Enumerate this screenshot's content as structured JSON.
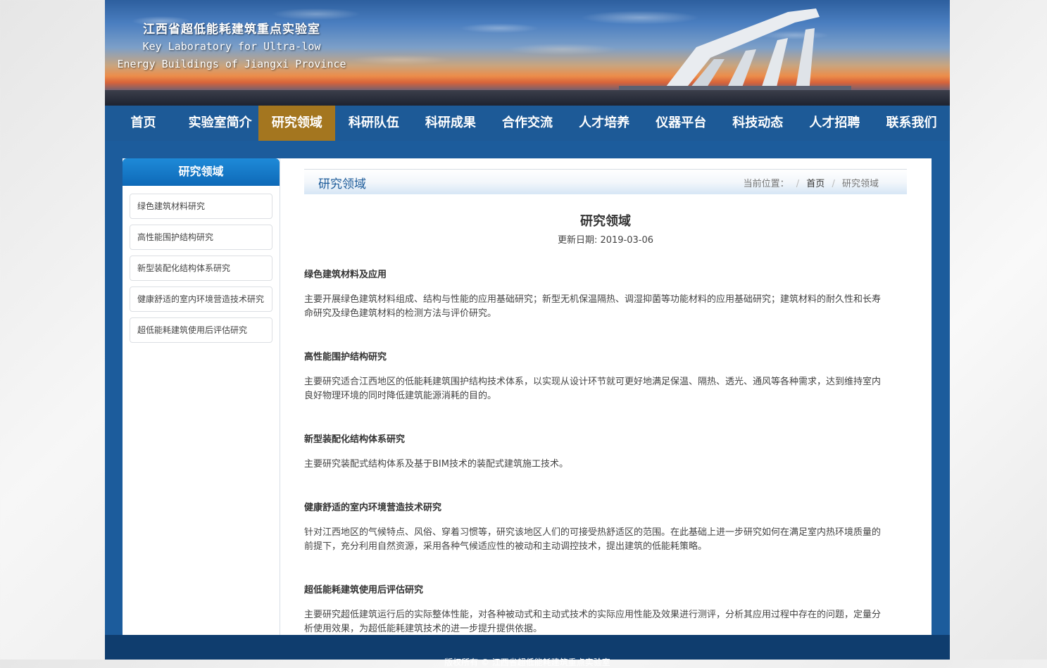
{
  "header": {
    "title_zh": "江西省超低能耗建筑重点实验室",
    "title_en_1": "Key Laboratory for Ultra-low",
    "title_en_2": "Energy Buildings of Jiangxi Province"
  },
  "nav": {
    "items": [
      "首页",
      "实验室简介",
      "研究领域",
      "科研队伍",
      "科研成果",
      "合作交流",
      "人才培养",
      "仪器平台",
      "科技动态",
      "人才招聘",
      "联系我们"
    ],
    "active": "研究领域"
  },
  "sidebar": {
    "title": "研究领域",
    "items": [
      "绿色建筑材料研究",
      "高性能围护结构研究",
      "新型装配化结构体系研究",
      "健康舒适的室内环境营造技术研究",
      "超低能耗建筑使用后评估研究"
    ]
  },
  "breadcrumb": {
    "section_title": "研究领域",
    "label": "当前位置：",
    "sep": "/",
    "home": "首页",
    "current": "研究领域"
  },
  "article": {
    "title": "研究领域",
    "date": "更新日期: 2019-03-06",
    "sections": [
      {
        "heading": "绿色建筑材料及应用",
        "body": "主要开展绿色建筑材料组成、结构与性能的应用基础研究；新型无机保温隔热、调湿抑菌等功能材料的应用基础研究；建筑材料的耐久性和长寿命研究及绿色建筑材料的检测方法与评价研究。"
      },
      {
        "heading": "高性能围护结构研究",
        "body": "主要研究适合江西地区的低能耗建筑围护结构技术体系，以实现从设计环节就可更好地满足保温、隔热、透光、通风等各种需求，达到维持室内良好物理环境的同时降低建筑能源消耗的目的。"
      },
      {
        "heading": "新型装配化结构体系研究",
        "body": "主要研究装配式结构体系及基于BIM技术的装配式建筑施工技术。"
      },
      {
        "heading": "健康舒适的室内环境营造技术研究",
        "body": "针对江西地区的气候特点、风俗、穿着习惯等，研究该地区人们的可接受热舒适区的范围。在此基础上进一步研究如何在满足室内热环境质量的前提下，充分利用自然资源，采用各种气候适应性的被动和主动调控技术，提出建筑的低能耗策略。"
      },
      {
        "heading": "超低能耗建筑使用后评估研究",
        "body": "主要研究超低建筑运行后的实际整体性能，对各种被动式和主动式技术的实际应用性能及效果进行测评，分析其应用过程中存在的问题，定量分析使用效果，为超低能耗建筑技术的进一步提升提供依据。"
      }
    ]
  },
  "footer": {
    "text": "版权所有 © 江西省超低能耗建筑重点实验室"
  },
  "colors": {
    "page_blue": "#1c5c9c",
    "nav_active": "#a4761f",
    "footer": "#0f3d6e",
    "sidebar_head": "#0e69b7"
  }
}
